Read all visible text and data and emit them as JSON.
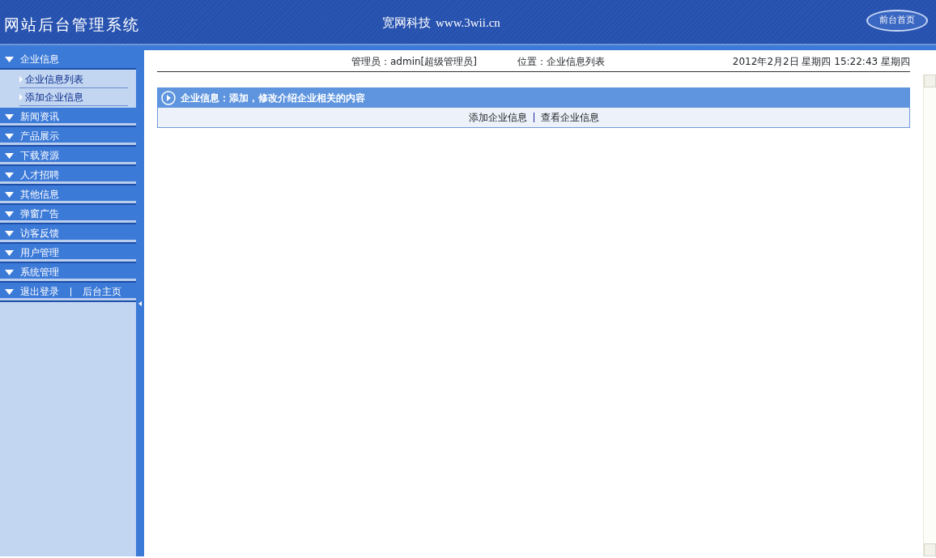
{
  "header": {
    "title": "网站后台管理系统",
    "company": "宽网科技",
    "url": "www.3wii.cn",
    "home_link": "前台首页"
  },
  "sidebar": {
    "groups": [
      {
        "label": "企业信息",
        "children": [
          {
            "label": "企业信息列表"
          },
          {
            "label": "添加企业信息"
          }
        ]
      },
      {
        "label": "新闻资讯"
      },
      {
        "label": "产品展示"
      },
      {
        "label": "下载资源"
      },
      {
        "label": "人才招聘"
      },
      {
        "label": "其他信息"
      },
      {
        "label": "弹窗广告"
      },
      {
        "label": "访客反馈"
      },
      {
        "label": "用户管理"
      },
      {
        "label": "系统管理"
      }
    ],
    "footer_links": [
      "退出登录",
      "后台主页"
    ]
  },
  "info_bar": {
    "admin": "管理员：admin[超级管理员]",
    "location": "位置：企业信息列表",
    "datetime": "2012年2月2日 星期四 15:22:43 星期四"
  },
  "panel": {
    "title": "企业信息：添加，修改介绍企业相关的内容",
    "links": [
      "添加企业信息",
      "查看企业信息"
    ]
  }
}
